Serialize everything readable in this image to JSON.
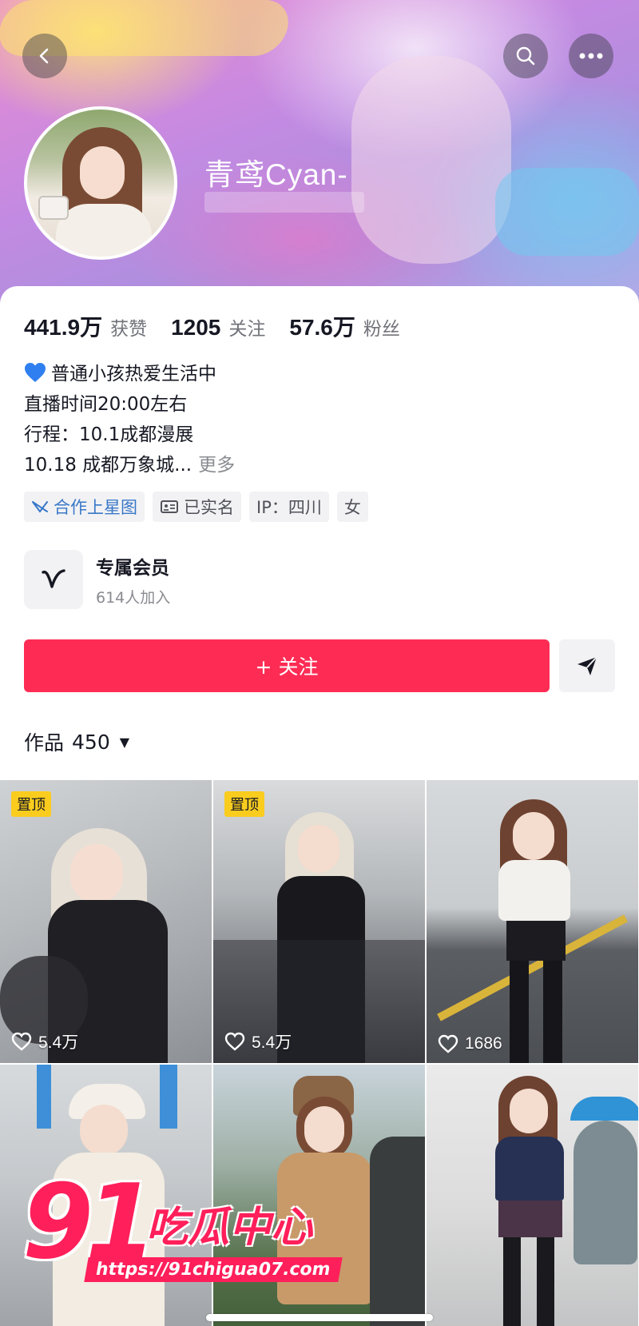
{
  "profile": {
    "nickname": "青鸢Cyan-"
  },
  "stats": [
    {
      "value": "441.9万",
      "label": "获赞"
    },
    {
      "value": "1205",
      "label": "关注"
    },
    {
      "value": "57.6万",
      "label": "粉丝"
    }
  ],
  "bio": {
    "line1": "普通小孩热爱生活中",
    "line2": "直播时间20:00左右",
    "line3": "行程：10.1成都漫展",
    "line4": "10.18 成都万象城...",
    "more": "更多"
  },
  "tags": [
    {
      "label": "合作上星图",
      "icon": "star-map-icon"
    },
    {
      "label": "已实名",
      "icon": "id-card-icon"
    },
    {
      "label": "IP：四川"
    },
    {
      "label": "女"
    }
  ],
  "member": {
    "title": "专属会员",
    "subtitle": "614人加入"
  },
  "actions": {
    "follow": "+ 关注"
  },
  "works": {
    "label": "作品",
    "count": "450"
  },
  "videos": [
    {
      "pinned": "置顶",
      "likes": "5.4万"
    },
    {
      "pinned": "置顶",
      "likes": "5.4万"
    },
    {
      "pinned": "",
      "likes": "1686"
    },
    {
      "pinned": "",
      "likes": ""
    },
    {
      "pinned": "",
      "likes": ""
    },
    {
      "pinned": "",
      "likes": ""
    }
  ],
  "watermark": {
    "number": "91",
    "name": "吃瓜中心",
    "url": "https://91chigua07.com"
  },
  "colors": {
    "accent": "#fe2c55",
    "pin_badge": "#facc1e",
    "tag_blue": "#3978c8"
  }
}
